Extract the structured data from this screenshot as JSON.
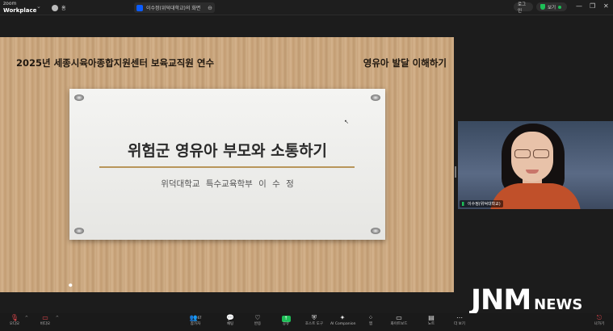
{
  "topbar": {
    "brand_line1": "zoom",
    "brand_line2": "Workplace",
    "home_tab": "홈",
    "meeting_tab": "이수정(위덕대학교)의 화면",
    "record_label": "로그인",
    "view_label": "보기",
    "min": "—",
    "restore": "❐",
    "close": "✕"
  },
  "slide": {
    "header_left": "2025년 세종시육아종합지원센터 보육교직원 연수",
    "header_right": "영유아 발달 이해하기",
    "title": "위험군 영유아 부모와 소통하기",
    "subtitle": "위덕대학교 특수교육학부   이 수 정"
  },
  "participant": {
    "name": "이수정(위덕대학교)"
  },
  "watermark": {
    "main": "JNM",
    "sub": "NEWS"
  },
  "toolbar": {
    "items": [
      {
        "label": "오디오",
        "icon": "mic-muted-icon",
        "glyph": "🎙"
      },
      {
        "label": "비디오",
        "icon": "video-off-icon",
        "glyph": "▭"
      },
      {
        "label": "참가자",
        "icon": "participants-icon",
        "glyph": "👥",
        "count": "67"
      },
      {
        "label": "채팅",
        "icon": "chat-icon",
        "glyph": "💬"
      },
      {
        "label": "반응",
        "icon": "reactions-icon",
        "glyph": "♡"
      },
      {
        "label": "공유",
        "icon": "share-icon",
        "glyph": "↑"
      },
      {
        "label": "호스트 도구",
        "icon": "host-tools-icon",
        "glyph": "⛨"
      },
      {
        "label": "AI Companion",
        "icon": "ai-companion-icon",
        "glyph": "✦"
      },
      {
        "label": "앱",
        "icon": "apps-icon",
        "glyph": "⁘"
      },
      {
        "label": "화이트보드",
        "icon": "whiteboard-icon",
        "glyph": "▭"
      },
      {
        "label": "노트",
        "icon": "notes-icon",
        "glyph": "▤"
      },
      {
        "label": "더 보기",
        "icon": "more-icon",
        "glyph": "⋯"
      },
      {
        "label": "나가기",
        "icon": "leave-icon",
        "glyph": "⎋"
      }
    ]
  },
  "colors": {
    "accent_green": "#1dbf57",
    "leave_red": "#e5484d",
    "zoom_blue": "#0b5cff"
  }
}
